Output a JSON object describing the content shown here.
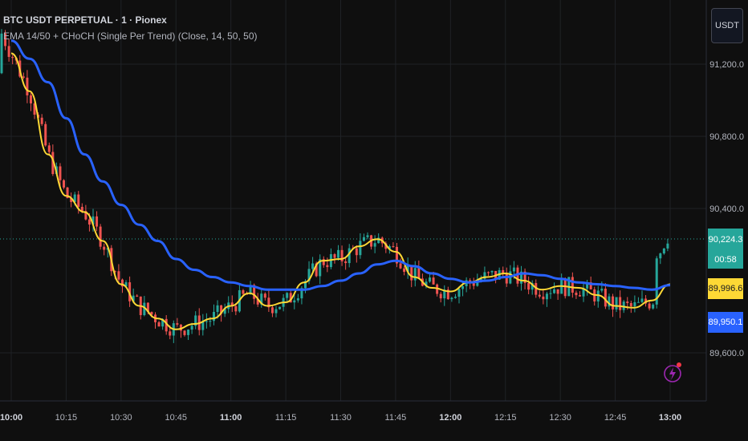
{
  "header": {
    "title": "BTC USDT PERPETUAL · 1 · Pionex",
    "indicator": "EMA 14/50 + CHoCH (Single Per Trend) (Close, 14, 50, 50)"
  },
  "currency_button": "USDT",
  "price_axis": {
    "labels": [
      "91,200.0",
      "90,800.0",
      "90,400.0",
      "89,600.0"
    ],
    "values": [
      91200,
      90800,
      90400,
      89600
    ]
  },
  "time_axis": {
    "labels": [
      "10:00",
      "10:15",
      "10:30",
      "10:45",
      "11:00",
      "11:15",
      "11:30",
      "11:45",
      "12:00",
      "12:15",
      "12:30",
      "12:45",
      "13:00"
    ],
    "bold": [
      "10:00",
      "11:00",
      "12:00",
      "13:00"
    ]
  },
  "price_tags": {
    "last_price": "90,224.3",
    "countdown": "00:58",
    "ema14": "89,996.6",
    "ema50": "89,950.1"
  },
  "colors": {
    "background": "#0f0f0f",
    "up": "#26a69a",
    "down": "#ef5350",
    "ema_fast": "#fdd835",
    "ema_slow": "#2962ff",
    "grid": "#1f2226",
    "last_price_line": "#26a69a",
    "accent_icon": "#9c27b0"
  },
  "chart_data": {
    "type": "line",
    "title": "BTC USDT PERPETUAL · 1 · Pionex",
    "x_axis": "time",
    "ylim": [
      89500,
      91300
    ],
    "grid": true,
    "series": [
      {
        "name": "EMA 14",
        "x": [
          "10:00",
          "10:05",
          "10:10",
          "10:15",
          "10:20",
          "10:25",
          "10:30",
          "10:35",
          "10:40",
          "10:45",
          "10:50",
          "10:55",
          "11:00",
          "11:05",
          "11:10",
          "11:15",
          "11:20",
          "11:25",
          "11:30",
          "11:35",
          "11:40",
          "11:45",
          "11:50",
          "11:55",
          "12:00",
          "12:05",
          "12:10",
          "12:15",
          "12:20",
          "12:25",
          "12:30",
          "12:35",
          "12:40",
          "12:45",
          "12:50",
          "12:55",
          "13:00"
        ],
        "values": [
          91260,
          91050,
          90700,
          90470,
          90380,
          90220,
          89980,
          89860,
          89790,
          89730,
          89760,
          89790,
          89860,
          89930,
          89860,
          89880,
          89990,
          90110,
          90120,
          90190,
          90230,
          90160,
          90020,
          89960,
          89940,
          89990,
          90020,
          90040,
          90000,
          89950,
          89970,
          89960,
          89920,
          89860,
          89850,
          89890,
          89980
        ]
      },
      {
        "name": "EMA 50",
        "x": [
          "10:00",
          "10:05",
          "10:10",
          "10:15",
          "10:20",
          "10:25",
          "10:30",
          "10:35",
          "10:40",
          "10:45",
          "10:50",
          "10:55",
          "11:00",
          "11:05",
          "11:10",
          "11:15",
          "11:20",
          "11:25",
          "11:30",
          "11:35",
          "11:40",
          "11:45",
          "11:50",
          "11:55",
          "12:00",
          "12:05",
          "12:10",
          "12:15",
          "12:20",
          "12:25",
          "12:30",
          "12:35",
          "12:40",
          "12:45",
          "12:50",
          "12:55",
          "13:00"
        ],
        "values": [
          91330,
          91230,
          91100,
          90900,
          90700,
          90550,
          90420,
          90310,
          90220,
          90120,
          90060,
          90020,
          89990,
          89970,
          89950,
          89950,
          89950,
          89970,
          90000,
          90040,
          90090,
          90110,
          90080,
          90040,
          90010,
          89990,
          90000,
          90020,
          90040,
          90030,
          90010,
          89990,
          89980,
          89970,
          89960,
          89950,
          89975
        ]
      }
    ]
  }
}
